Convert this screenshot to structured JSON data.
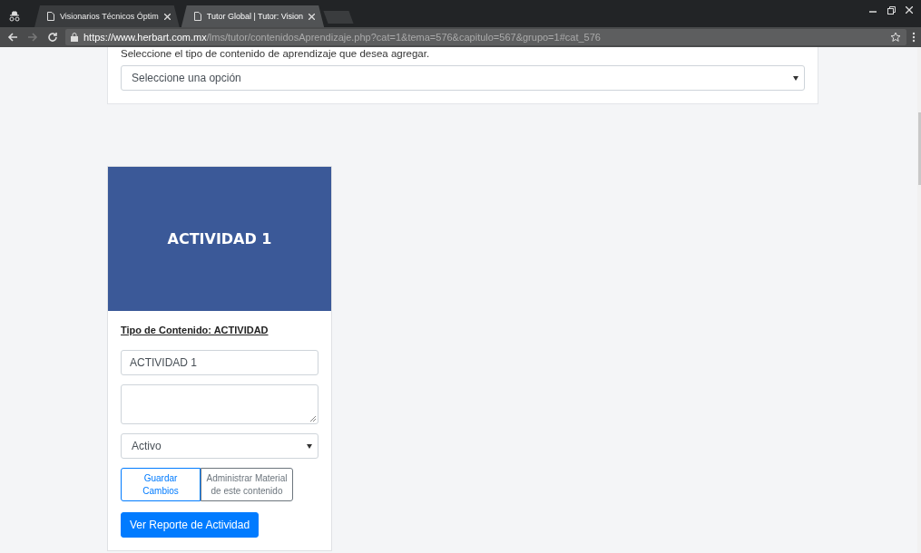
{
  "browser": {
    "tabs": [
      {
        "title": "Visionarios Técnicos Óptim",
        "selected": false
      },
      {
        "title": "Tutor Global | Tutor: Vision",
        "selected": true
      }
    ],
    "url": {
      "host": "https://www.herbart.com.mx",
      "path": "/lms/tutor/contenidosAprendizaje.php?cat=1&tema=576&capitulo=567&grupo=1#cat_576"
    }
  },
  "content_type_panel": {
    "prompt": "Seleccione el tipo de contenido de aprendizaje que desea agregar.",
    "select_value": "Seleccione una opción"
  },
  "activity_card": {
    "title": "ACTIVIDAD 1",
    "type_label": "Tipo de Contenido: ACTIVIDAD",
    "name_value": "ACTIVIDAD 1",
    "status_value": "Activo",
    "buttons": [
      {
        "label": "Guardar Cambios",
        "kind": "primary-outline"
      },
      {
        "label": "Administrar Material de este contenido",
        "kind": "secondary-outline"
      }
    ],
    "report_button": {
      "label": "Ver Reporte de Actividad",
      "kind": "primary"
    }
  }
}
